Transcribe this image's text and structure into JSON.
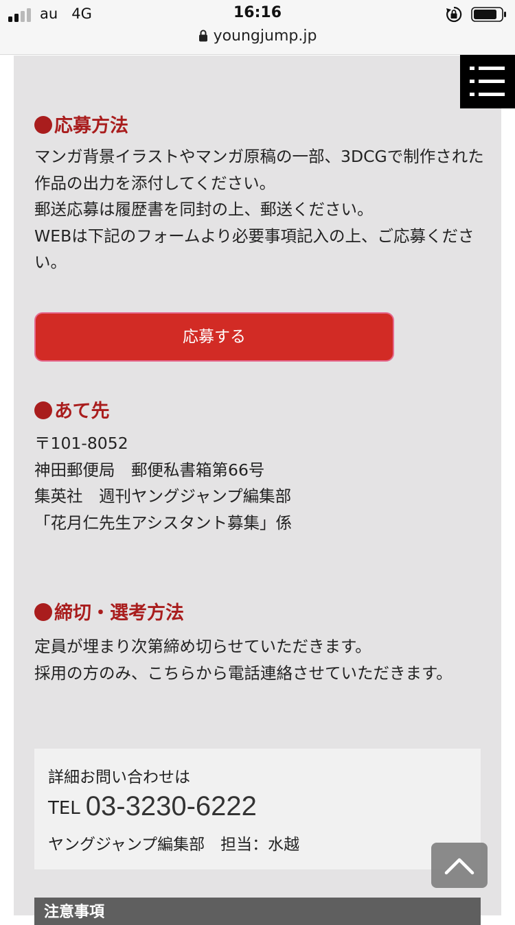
{
  "status_bar": {
    "carrier": "au",
    "network": "4G",
    "time": "16:16",
    "icons": [
      "signal-icon",
      "rotation-lock-icon",
      "battery-icon"
    ]
  },
  "browser": {
    "url": "youngjump.jp",
    "icons": [
      "lock-icon"
    ]
  },
  "menu": {
    "icon": "hamburger-menu-icon"
  },
  "sections": {
    "apply_method": {
      "title": "応募方法",
      "body": "マンガ背景イラストやマンガ原稿の一部、3DCGで制作された作品の出力を添付してください。\n郵送応募は履歴書を同封の上、郵送ください。\nWEBは下記のフォームより必要事項記入の上、ご応募ください。",
      "button_label": "応募する"
    },
    "address": {
      "title": "あて先",
      "body": "〒101-8052\n神田郵便局　郵便私書箱第66号\n集英社　週刊ヤングジャンプ編集部\n「花月仁先生アシスタント募集」係"
    },
    "deadline": {
      "title": "締切・選考方法",
      "body": "定員が埋まり次第締め切らせていただきます。\n採用の方のみ、こちらから電話連絡させていただきます。"
    }
  },
  "contact": {
    "intro": "詳細お問い合わせは",
    "tel_label": "TEL",
    "tel_number": "03-3230-6222",
    "department": "ヤングジャンプ編集部　担当：水越"
  },
  "notes": {
    "title": "注意事項"
  },
  "back_to_top": {
    "icon": "chevron-up-icon"
  },
  "colors": {
    "accent_red": "#a91d1d",
    "button_red": "#d22b25",
    "page_bg": "#e4e3e4"
  }
}
